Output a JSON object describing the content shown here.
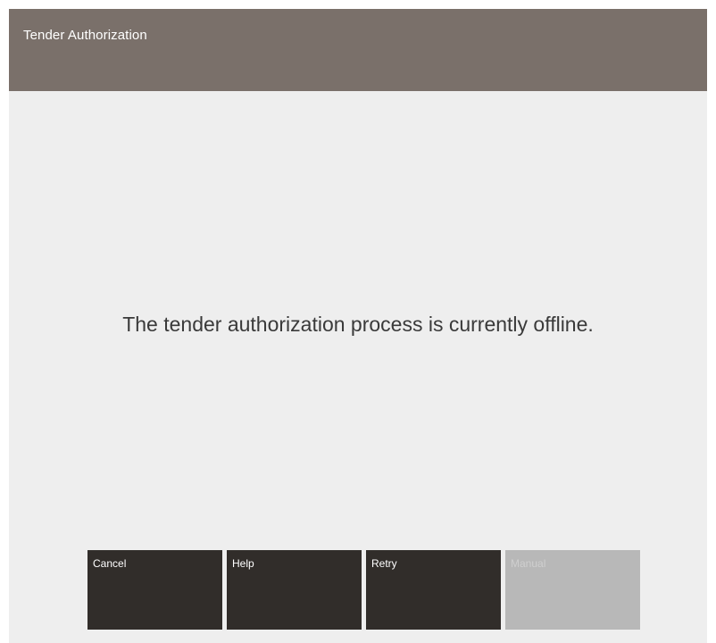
{
  "header": {
    "title": "Tender Authorization"
  },
  "main": {
    "message": "The tender authorization process is currently offline."
  },
  "buttons": [
    {
      "label": "Cancel",
      "enabled": true
    },
    {
      "label": "Help",
      "enabled": true
    },
    {
      "label": "Retry",
      "enabled": true
    },
    {
      "label": "Manual",
      "enabled": false
    }
  ],
  "colors": {
    "title_bar": "#7a706a",
    "background": "#eeeeee",
    "button": "#312d2a",
    "button_disabled": "#b8b8b8",
    "message_text": "#3a3a3a"
  }
}
